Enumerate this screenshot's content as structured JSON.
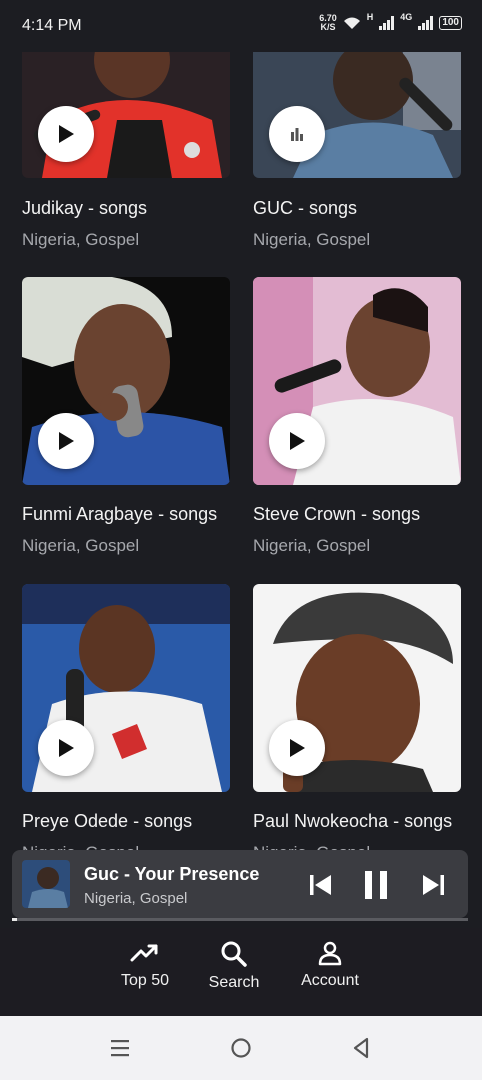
{
  "status": {
    "time": "4:14 PM",
    "speed_value": "6.70",
    "speed_unit": "K/S",
    "net1": "H",
    "net2": "4G",
    "battery": "100"
  },
  "artists": [
    {
      "title": "Judikay - songs",
      "subtitle": "Nigeria, Gospel",
      "play_state": "play"
    },
    {
      "title": "GUC - songs",
      "subtitle": "Nigeria, Gospel",
      "play_state": "playing"
    },
    {
      "title": "Funmi Aragbaye - songs",
      "subtitle": "Nigeria, Gospel",
      "play_state": "play"
    },
    {
      "title": "Steve Crown - songs",
      "subtitle": "Nigeria, Gospel",
      "play_state": "play"
    },
    {
      "title": "Preye Odede - songs",
      "subtitle": "Nigeria, Gospel",
      "play_state": "play"
    },
    {
      "title": "Paul Nwokeocha - songs",
      "subtitle": "Nigeria, Gospel",
      "play_state": "play"
    }
  ],
  "player": {
    "title": "Guc - Your Presence",
    "subtitle": "Nigeria, Gospel",
    "progress": 0.01
  },
  "nav": {
    "top50": "Top 50",
    "search": "Search",
    "account": "Account"
  },
  "colors": {
    "background": "#1c1d22",
    "player_bg": "#3b3c41",
    "subtitle": "#a6a8ad"
  }
}
